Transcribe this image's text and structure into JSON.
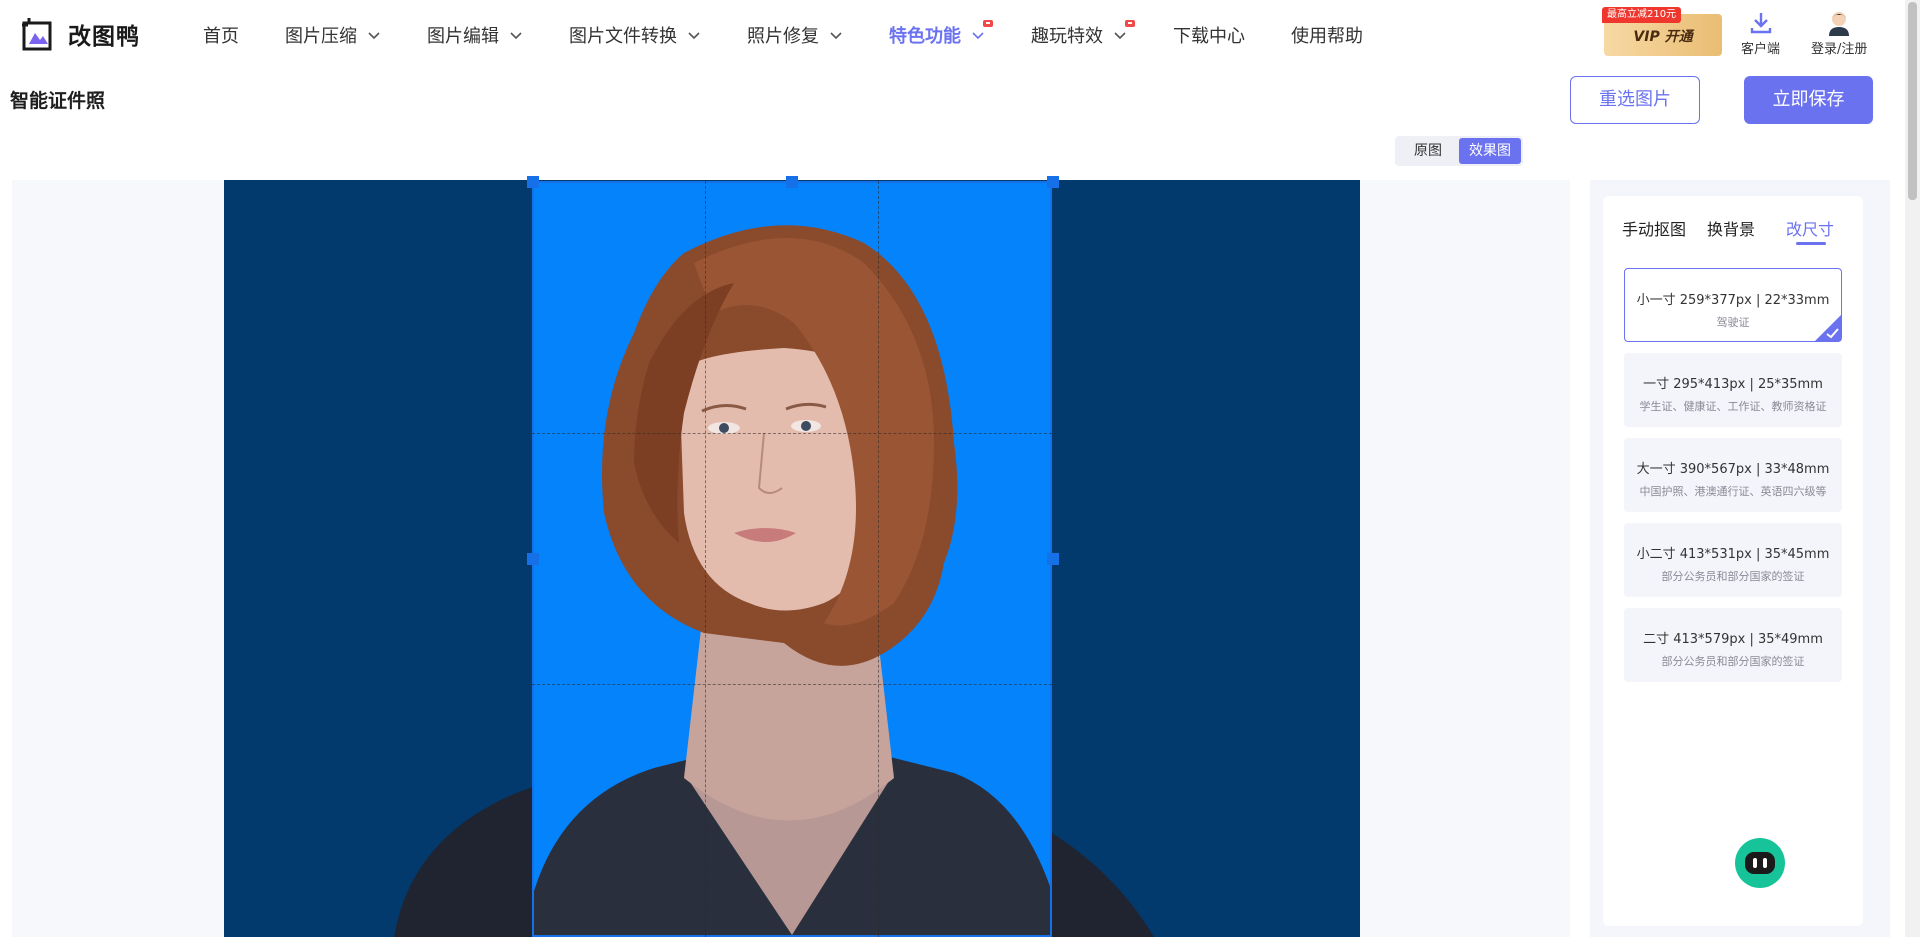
{
  "app": {
    "name": "改图鸭"
  },
  "nav": [
    {
      "label": "首页",
      "dropdown": false,
      "active": false,
      "dot": false
    },
    {
      "label": "图片压缩",
      "dropdown": true,
      "active": false,
      "dot": false
    },
    {
      "label": "图片编辑",
      "dropdown": true,
      "active": false,
      "dot": false
    },
    {
      "label": "图片文件转换",
      "dropdown": true,
      "active": false,
      "dot": false
    },
    {
      "label": "照片修复",
      "dropdown": true,
      "active": false,
      "dot": false
    },
    {
      "label": "特色功能",
      "dropdown": true,
      "active": true,
      "dot": true
    },
    {
      "label": "趣玩特效",
      "dropdown": true,
      "active": false,
      "dot": true
    },
    {
      "label": "下载中心",
      "dropdown": false,
      "active": false,
      "dot": false
    },
    {
      "label": "使用帮助",
      "dropdown": false,
      "active": false,
      "dot": false
    }
  ],
  "vip": {
    "tag": "最高立减210元",
    "label": "VIP 开通"
  },
  "header_icons": {
    "client": "客户端",
    "login": "登录/注册"
  },
  "toolbar": {
    "title": "智能证件照",
    "reselect": "重选图片",
    "save": "立即保存",
    "view_original": "原图",
    "view_result": "效果图"
  },
  "panel": {
    "tabs": [
      "手动抠图",
      "换背景",
      "改尺寸"
    ],
    "active_tab": "改尺寸",
    "sizes": [
      {
        "title": "小一寸 259*377px | 22*33mm",
        "desc": "驾驶证",
        "selected": true
      },
      {
        "title": "一寸 295*413px | 25*35mm",
        "desc": "学生证、健康证、工作证、教师资格证",
        "selected": false
      },
      {
        "title": "大一寸 390*567px | 33*48mm",
        "desc": "中国护照、港澳通行证、英语四六级等",
        "selected": false
      },
      {
        "title": "小二寸 413*531px | 35*45mm",
        "desc": "部分公务员和部分国家的签证",
        "selected": false
      },
      {
        "title": "二寸 413*579px | 35*49mm",
        "desc": "部分公务员和部分国家的签证",
        "selected": false
      }
    ]
  },
  "colors": {
    "accent": "#6b72f0",
    "photo_bg": "#033a6e",
    "crop_bg": "#0583fb",
    "crop_border": "#1670e8",
    "bot": "#17c499"
  },
  "icons": {
    "logo": "logo-icon",
    "chevron": "chevron-down-icon",
    "client": "download-icon",
    "login": "avatar-icon",
    "bot": "robot-icon",
    "check": "check-icon"
  }
}
